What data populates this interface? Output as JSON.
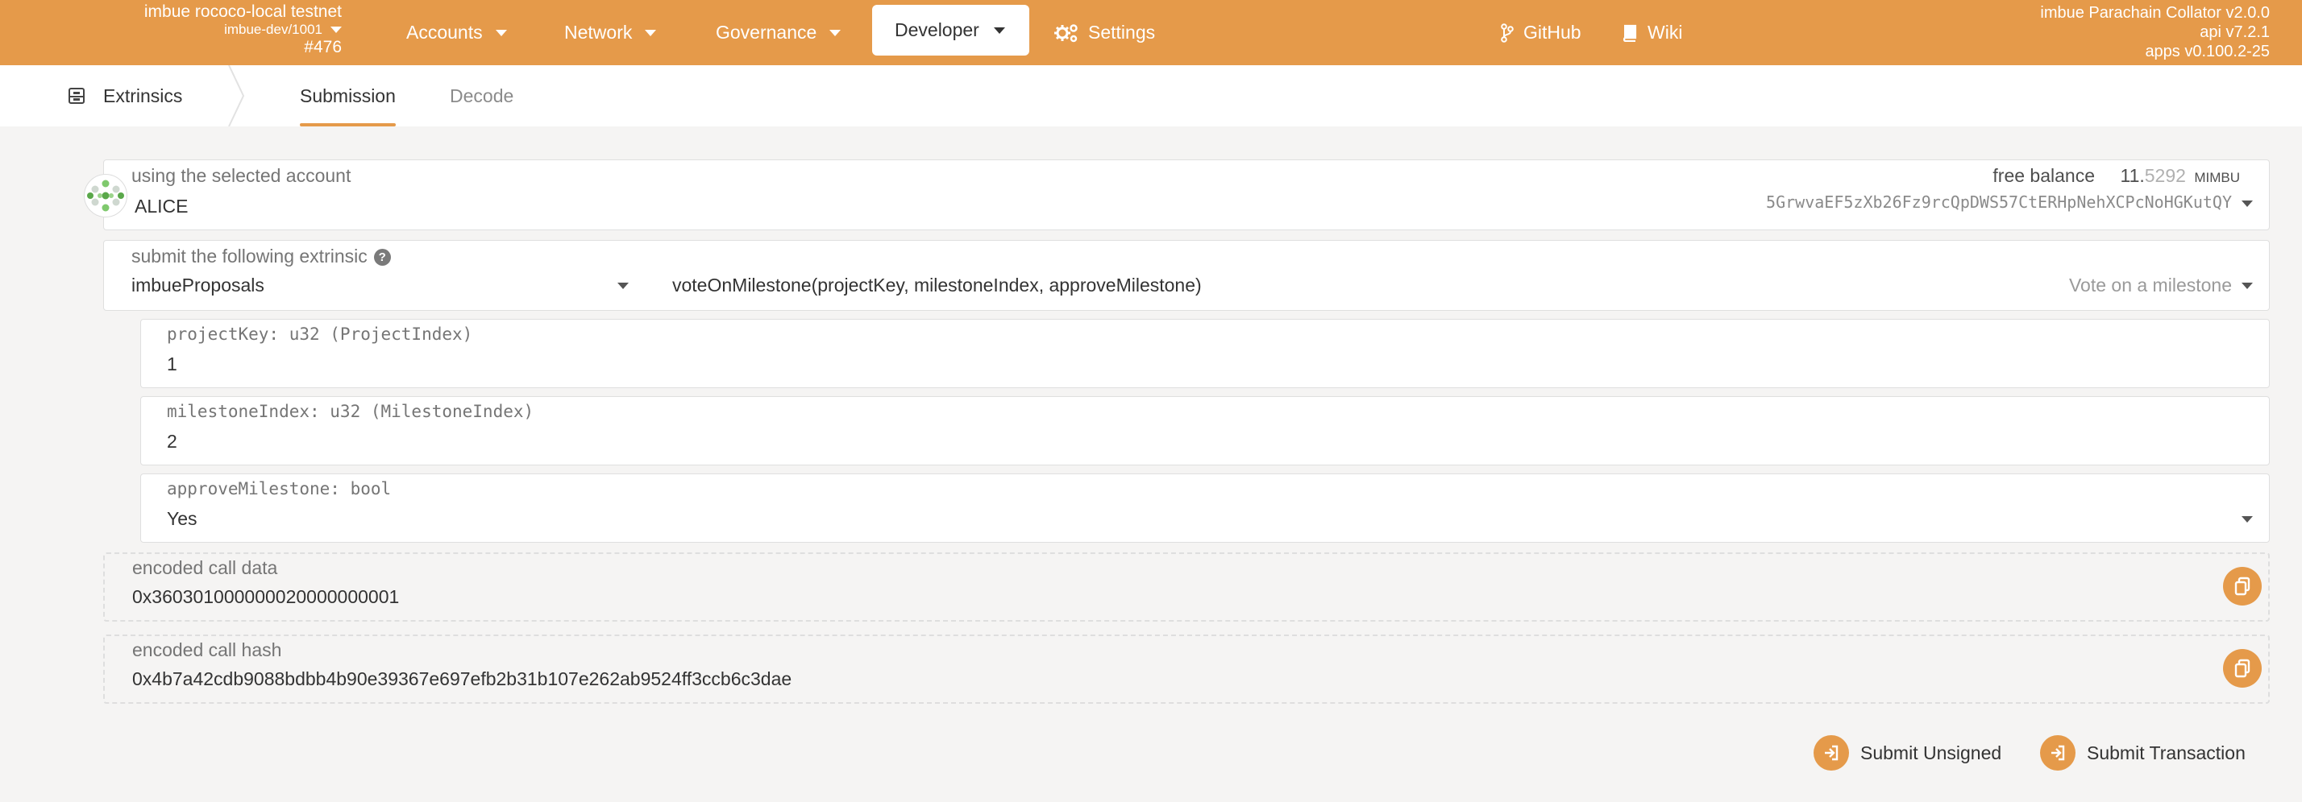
{
  "header": {
    "chain_name": "imbue rococo-local testnet",
    "spec": "imbue-dev/1001",
    "block": "#476",
    "nav": {
      "accounts": "Accounts",
      "network": "Network",
      "governance": "Governance",
      "developer": "Developer",
      "settings": "Settings",
      "github": "GitHub",
      "wiki": "Wiki"
    },
    "version": {
      "node": "imbue Parachain Collator v2.0.0",
      "api": "api v7.2.1",
      "apps": "apps v0.100.2-25"
    },
    "accent_color": "#e59a4a"
  },
  "subnav": {
    "home": "Extrinsics",
    "tabs": [
      "Submission",
      "Decode"
    ],
    "active_tab": "Submission"
  },
  "account": {
    "label": "using the selected account",
    "name": "ALICE",
    "balance_label": "free balance",
    "balance_int": "11.",
    "balance_frac": "5292",
    "balance_unit": "MIMBU",
    "address": "5GrwvaEF5zXb26Fz9rcQpDWS57CtERHpNehXCPcNoHGKutQY"
  },
  "extrinsic": {
    "label": "submit the following extrinsic",
    "pallet": "imbueProposals",
    "call": "voteOnMilestone(projectKey, milestoneIndex, approveMilestone)",
    "call_doc": "Vote on a milestone"
  },
  "params": [
    {
      "label": "projectKey: u32 (ProjectIndex)",
      "value": "1"
    },
    {
      "label": "milestoneIndex: u32 (MilestoneIndex)",
      "value": "2"
    },
    {
      "label": "approveMilestone: bool",
      "value": "Yes"
    }
  ],
  "encoded": {
    "call_data_label": "encoded call data",
    "call_data": "0x360301000000020000000001",
    "call_hash_label": "encoded call hash",
    "call_hash": "0x4b7a42cdb9088bdbb4b90e39367e697efb2b31b107e262ab9524ff3ccb6c3dae"
  },
  "actions": {
    "submit_unsigned": "Submit Unsigned",
    "submit_transaction": "Submit Transaction"
  },
  "icons": [
    "chevron-down-icon",
    "gears-icon",
    "git-branch-icon",
    "book-icon",
    "extrinsics-icon",
    "help-icon",
    "copy-icon",
    "sign-in-icon",
    "identicon"
  ]
}
